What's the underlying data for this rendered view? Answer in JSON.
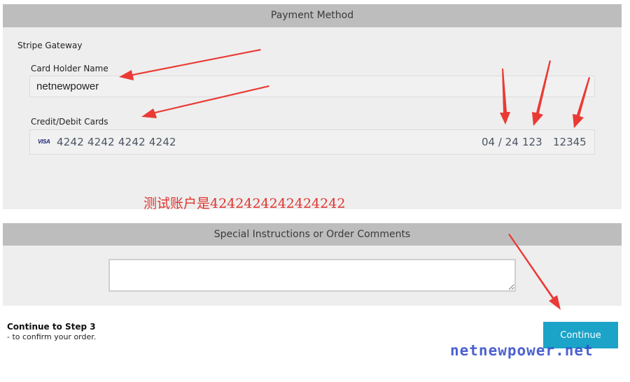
{
  "payment": {
    "title": "Payment Method",
    "gateway_label": "Stripe Gateway",
    "holder_label": "Card Holder Name",
    "holder_value": "netnewpower",
    "card_label": "Credit/Debit Cards",
    "card_brand": "VISA",
    "card_number": "4242 4242 4242 4242",
    "card_expiry": "04 / 24",
    "card_cvc": "123",
    "card_zip": "12345",
    "test_note": "测试账户是4242424242424242"
  },
  "instructions": {
    "title": "Special Instructions or Order Comments",
    "value": ""
  },
  "footer": {
    "step_title": "Continue to Step 3",
    "step_subtitle": "- to confirm your order.",
    "continue_label": "Continue"
  },
  "watermark": "netnewpower.net",
  "colors": {
    "header_bg": "#bdbdbd",
    "panel_bg": "#eeeeee",
    "button": "#1ba3c8",
    "annotation": "#e0342f",
    "watermark": "#2d46c6"
  },
  "icons": [
    "visa-card-icon",
    "annotation-arrow"
  ]
}
